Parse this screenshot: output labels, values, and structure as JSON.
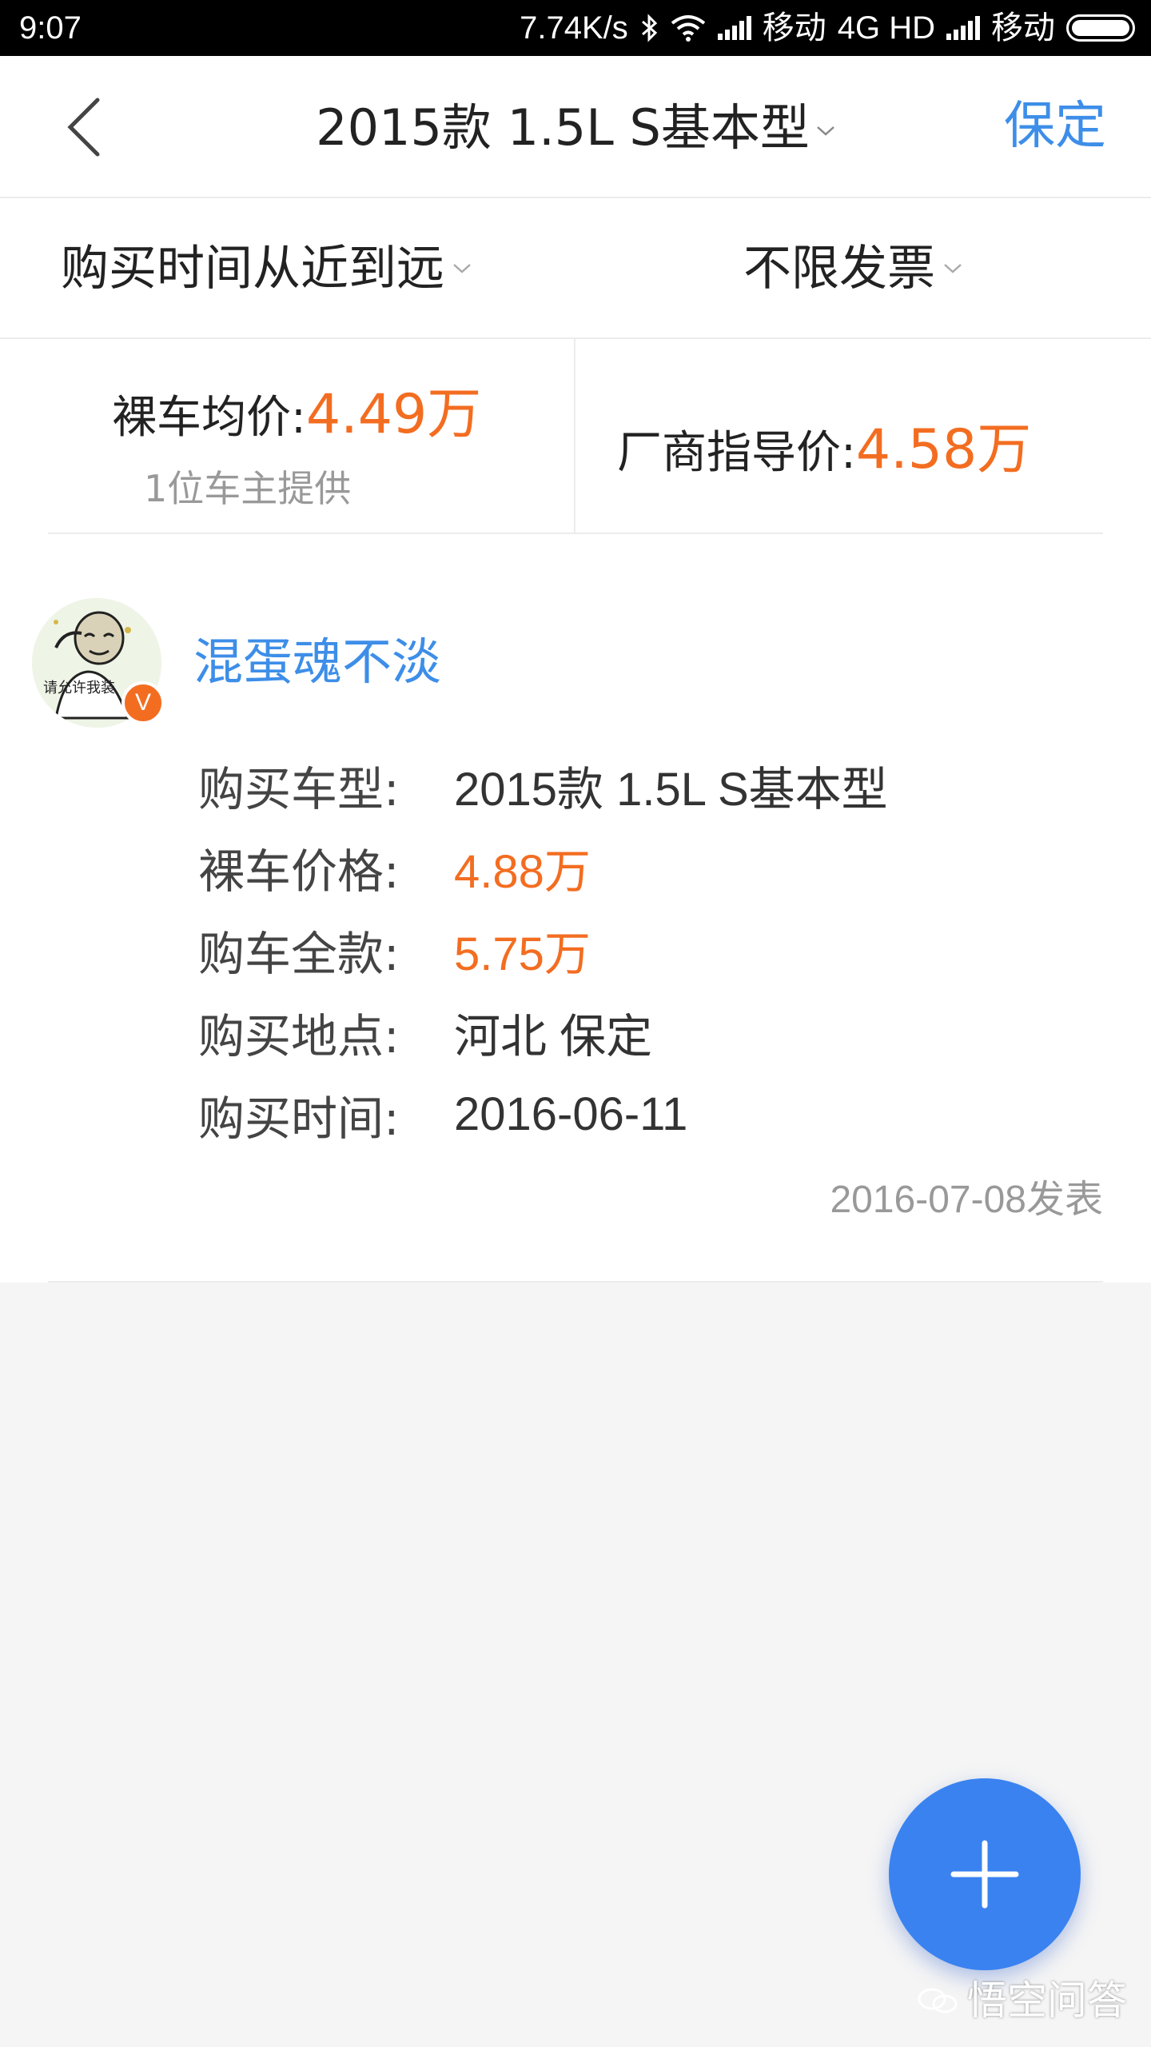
{
  "status_bar": {
    "time": "9:07",
    "speed": "7.74K/s",
    "carrier1": "移动",
    "network": "4G HD",
    "carrier2": "移动"
  },
  "nav": {
    "title": "2015款 1.5L S基本型",
    "city": "保定",
    "back_icon": "chevron-left-icon",
    "title_dropdown_icon": "chevron-down-icon"
  },
  "filters": {
    "sort_label": "购买时间从近到远",
    "invoice_label": "不限发票"
  },
  "prices": {
    "avg_label": "裸车均价:",
    "avg_value": "4.49万",
    "avg_sub": "1位车主提供",
    "guide_label": "厂商指导价:",
    "guide_value": "4.58万"
  },
  "review": {
    "username": "混蛋魂不淡",
    "badge": "V",
    "avatar_caption": "请允许我装",
    "details": [
      {
        "label": "购买车型:",
        "value": "2015款 1.5L S基本型"
      },
      {
        "label": "裸车价格:",
        "value": "4.88万"
      },
      {
        "label": "购车全款:",
        "value": "5.75万"
      },
      {
        "label": "购买地点:",
        "value": "河北 保定"
      },
      {
        "label": "购买时间:",
        "value": "2016-06-11"
      }
    ],
    "post_date": "2016-07-08发表"
  },
  "fab": {
    "icon": "plus-icon"
  },
  "watermark": {
    "text": "悟空问答"
  },
  "colors": {
    "accent_blue": "#3d8ee8",
    "price_orange": "#f36d21",
    "fab_blue": "#3a82f0"
  }
}
